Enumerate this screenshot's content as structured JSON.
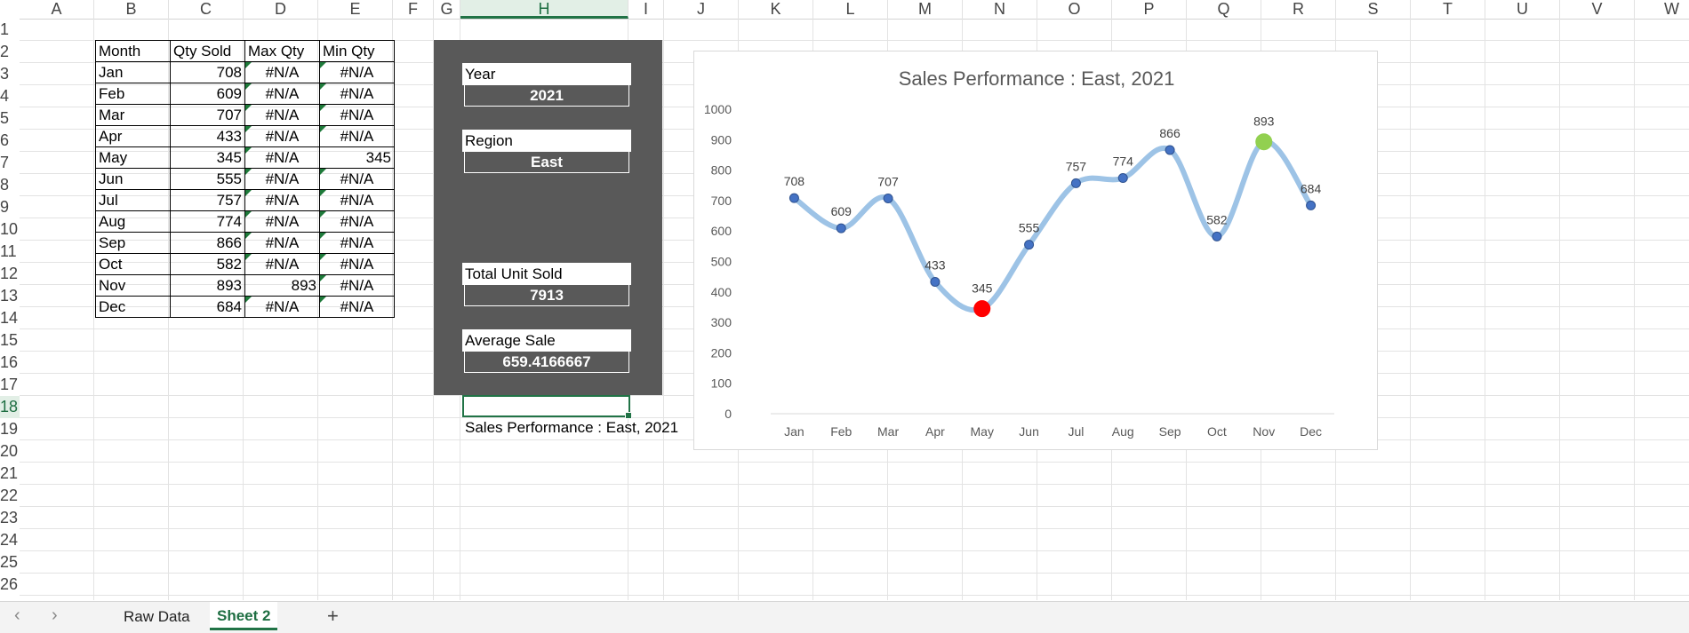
{
  "columns": [
    "A",
    "B",
    "C",
    "D",
    "E",
    "F",
    "G",
    "H",
    "I",
    "J",
    "K",
    "L",
    "M",
    "N",
    "O",
    "P",
    "Q",
    "R",
    "S",
    "T",
    "U",
    "V",
    "W"
  ],
  "rows": [
    "1",
    "2",
    "3",
    "4",
    "5",
    "6",
    "7",
    "8",
    "9",
    "10",
    "11",
    "12",
    "13",
    "14",
    "15",
    "16",
    "17",
    "18",
    "19",
    "20",
    "21",
    "22",
    "23",
    "24",
    "25",
    "26"
  ],
  "selected_column": "H",
  "selected_row": "18",
  "table": {
    "headers": [
      "Month",
      "Qty Sold",
      "Max Qty",
      "Min Qty"
    ],
    "rows": [
      [
        "Jan",
        "708",
        "#N/A",
        "#N/A"
      ],
      [
        "Feb",
        "609",
        "#N/A",
        "#N/A"
      ],
      [
        "Mar",
        "707",
        "#N/A",
        "#N/A"
      ],
      [
        "Apr",
        "433",
        "#N/A",
        "#N/A"
      ],
      [
        "May",
        "345",
        "#N/A",
        "345"
      ],
      [
        "Jun",
        "555",
        "#N/A",
        "#N/A"
      ],
      [
        "Jul",
        "757",
        "#N/A",
        "#N/A"
      ],
      [
        "Aug",
        "774",
        "#N/A",
        "#N/A"
      ],
      [
        "Sep",
        "866",
        "#N/A",
        "#N/A"
      ],
      [
        "Oct",
        "582",
        "#N/A",
        "#N/A"
      ],
      [
        "Nov",
        "893",
        "893",
        "#N/A"
      ],
      [
        "Dec",
        "684",
        "#N/A",
        "#N/A"
      ]
    ]
  },
  "dashboard": {
    "year_label": "Year",
    "year_value": "2021",
    "region_label": "Region",
    "region_value": "East",
    "total_label": "Total Unit Sold",
    "total_value": "7913",
    "avg_label": "Average Sale",
    "avg_value": "659.4166667",
    "caption": "Sales Performance : East, 2021"
  },
  "chart_data": {
    "type": "line",
    "title": "Sales Performance : East, 2021",
    "categories": [
      "Jan",
      "Feb",
      "Mar",
      "Apr",
      "May",
      "Jun",
      "Jul",
      "Aug",
      "Sep",
      "Oct",
      "Nov",
      "Dec"
    ],
    "series": [
      {
        "values": [
          708,
          609,
          707,
          433,
          345,
          555,
          757,
          774,
          866,
          582,
          893,
          684
        ]
      }
    ],
    "min_point": {
      "category": "May",
      "value": 345,
      "color": "#ff0000"
    },
    "max_point": {
      "category": "Nov",
      "value": 893,
      "color": "#92d050"
    },
    "ylim": [
      0,
      1000
    ],
    "yticks": [
      "0",
      "100",
      "200",
      "300",
      "400",
      "500",
      "600",
      "700",
      "800",
      "900",
      "1000"
    ],
    "line_color": "#9dc3e6",
    "marker_color": "#4472c4",
    "grid": false
  },
  "sheet_tabs": [
    "Raw Data",
    "Sheet 2"
  ],
  "active_tab": "Sheet 2",
  "add_tab_label": "+",
  "nav": {
    "prev": "‹",
    "next": "›"
  }
}
